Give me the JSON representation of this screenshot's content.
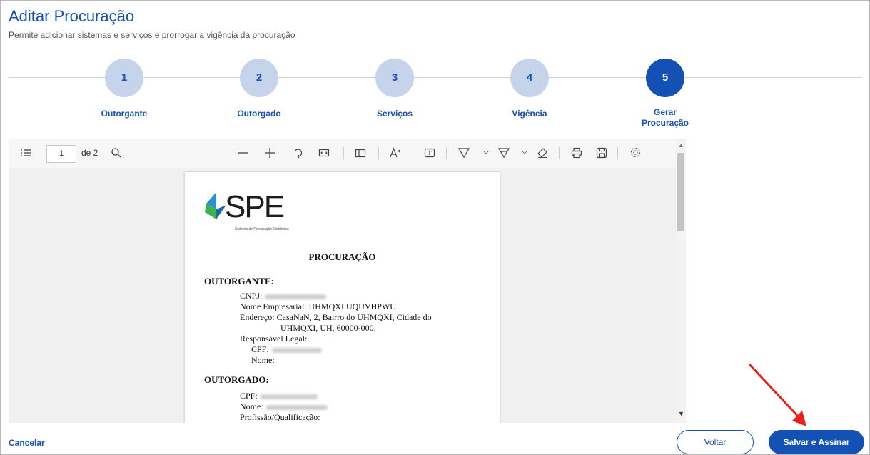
{
  "header": {
    "title": "Aditar Procuração",
    "subtitle": "Permite adicionar sistemas e serviços e prorrogar a vigência da procuração"
  },
  "steps": [
    {
      "number": "1",
      "label": "Outorgante"
    },
    {
      "number": "2",
      "label": "Outorgado"
    },
    {
      "number": "3",
      "label": "Serviços"
    },
    {
      "number": "4",
      "label": "Vigência"
    },
    {
      "number": "5",
      "label": "Gerar Procuração",
      "active": true
    }
  ],
  "viewer": {
    "current_page": "1",
    "page_count": "de 2",
    "icons": [
      "list-icon",
      "search-icon",
      "zoom-out-icon",
      "zoom-in-icon",
      "rotate-icon",
      "fit-width-icon",
      "page-view-icon",
      "text-size-icon",
      "text-box-icon",
      "draw-icon",
      "highlight-icon",
      "eraser-icon",
      "print-icon",
      "save-icon",
      "settings-icon"
    ]
  },
  "document": {
    "logo_text": "SPE",
    "logo_subtitle": "Sistema de Procuração Eletrônica",
    "title": "PROCURAÇÃO",
    "outorgante_heading": "OUTORGANTE:",
    "cnpj_label": "CNPJ:",
    "nome_empresarial": "Nome Empresarial: UHMQXI UQUVHPWU",
    "endereco_1": "Endereço: CasaNaN, 2, Bairro do UHMQXI, Cidade do",
    "endereco_2": "UHMQXI, UH, 60000-000.",
    "responsavel": "Responsável Legal:",
    "cpf_label": "CPF:",
    "nome_label": "Nome:",
    "outorgado_heading": "OUTORGADO:",
    "outorgado_cpf_label": "CPF:",
    "outorgado_nome_label": "Nome:",
    "partial_line": "Profissão/Qualificação:"
  },
  "footer": {
    "cancel_label": "Cancelar",
    "back_label": "Voltar",
    "save_label": "Salvar e Assinar"
  },
  "colors": {
    "primary": "#1351b4",
    "step_inactive": "#c5d4eb",
    "annotation_arrow": "#e8201c"
  }
}
